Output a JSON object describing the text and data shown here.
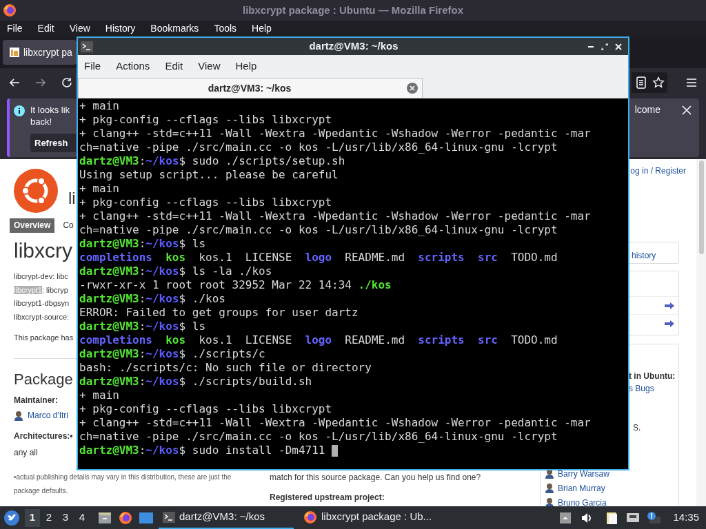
{
  "firefox": {
    "title": "libxcrypt package : Ubuntu — Mozilla Firefox",
    "menu": [
      "File",
      "Edit",
      "View",
      "History",
      "Bookmarks",
      "Tools",
      "Help"
    ],
    "tab": {
      "title": "libxcrypt pa"
    },
    "notification": {
      "lines": [
        "It looks lik",
        "back!"
      ],
      "button": "Refresh",
      "message_end": "lcome"
    }
  },
  "page": {
    "login": "og in / Register",
    "logo_subtitle": "li",
    "tabs": [
      {
        "label": "Overview",
        "selected": true
      },
      {
        "label": "Co",
        "selected": false
      }
    ],
    "heading": "libxcry",
    "packages": [
      {
        "name": "libcrypt-dev",
        "rest": ": libc",
        "selected": false
      },
      {
        "name": "libcrypt1",
        "rest": ": libcryp",
        "selected": true
      },
      {
        "name": "libcrypt1-dbgsyn",
        "selected": false
      },
      {
        "name": "libxcrypt-source",
        "rest": ":",
        "selected": false
      }
    ],
    "note": "This package has",
    "section_title": "Package",
    "maintainer_label": "Maintainer:",
    "maintainer": "Marco d'Itri",
    "architectures_label": "Architectures:•",
    "architectures": "any all",
    "footnote": [
      "•actual publishing details may vary in this distribution, these are just the",
      "package defaults."
    ],
    "upstream_note": "match for this source package. Can you help us find one?",
    "upstream_label": "Registered upstream project:",
    "sidebar": {
      "history_link": "history",
      "ubuntu_label": "t in Ubuntu:",
      "bugs_link": "s Bugs",
      "credit": "S.",
      "people": [
        "Barry Warsaw",
        "Brian Murray",
        "Bruno Garcia"
      ]
    }
  },
  "terminal": {
    "title": "dartz@VM3: ~/kos",
    "menu": [
      "File",
      "Actions",
      "Edit",
      "View",
      "Help"
    ],
    "tabs": [
      {
        "title": "dartz@VM3: ~/kos",
        "selected": true
      }
    ],
    "cursor": true,
    "lines": [
      {
        "kind": "output",
        "parts": [
          {
            "text": "+ main",
            "kind": "plain"
          }
        ]
      },
      {
        "kind": "output",
        "parts": [
          {
            "text": "+ pkg-config --cflags --libs libxcrypt",
            "kind": "plain"
          }
        ]
      },
      {
        "kind": "output",
        "parts": [
          {
            "text": "+ clang++ -std=c++11 -Wall -Wextra -Wpedantic -Wshadow -Werror -pedantic -mar",
            "kind": "plain"
          }
        ]
      },
      {
        "kind": "output",
        "parts": [
          {
            "text": "ch=native -pipe ./src/main.cc -o kos -L/usr/lib/x86_64-linux-gnu -lcrypt",
            "kind": "plain"
          }
        ]
      },
      {
        "kind": "prompt",
        "parts": [
          {
            "text": "dartz@VM3",
            "kind": "user"
          },
          {
            "text": ":",
            "kind": "plain"
          },
          {
            "text": "~/kos",
            "kind": "path"
          },
          {
            "text": "$ sudo ./scripts/setup.sh",
            "kind": "plain"
          }
        ]
      },
      {
        "kind": "output",
        "parts": [
          {
            "text": "Using setup script... please be careful",
            "kind": "plain"
          }
        ]
      },
      {
        "kind": "output",
        "parts": [
          {
            "text": "+ main",
            "kind": "plain"
          }
        ]
      },
      {
        "kind": "output",
        "parts": [
          {
            "text": "+ pkg-config --cflags --libs libxcrypt",
            "kind": "plain"
          }
        ]
      },
      {
        "kind": "output",
        "parts": [
          {
            "text": "+ clang++ -std=c++11 -Wall -Wextra -Wpedantic -Wshadow -Werror -pedantic -mar",
            "kind": "plain"
          }
        ]
      },
      {
        "kind": "output",
        "parts": [
          {
            "text": "ch=native -pipe ./src/main.cc -o kos -L/usr/lib/x86_64-linux-gnu -lcrypt",
            "kind": "plain"
          }
        ]
      },
      {
        "kind": "prompt",
        "parts": [
          {
            "text": "dartz@VM3",
            "kind": "user"
          },
          {
            "text": ":",
            "kind": "plain"
          },
          {
            "text": "~/kos",
            "kind": "path"
          },
          {
            "text": "$ ls",
            "kind": "plain"
          }
        ]
      },
      {
        "kind": "listing",
        "parts": [
          {
            "text": "completions",
            "kind": "dir"
          },
          {
            "text": "kos",
            "kind": "exec"
          },
          {
            "text": "kos.1",
            "kind": "plain"
          },
          {
            "text": "LICENSE",
            "kind": "plain"
          },
          {
            "text": "logo",
            "kind": "dir"
          },
          {
            "text": "README.md",
            "kind": "plain"
          },
          {
            "text": "scripts",
            "kind": "dir"
          },
          {
            "text": "src",
            "kind": "dir"
          },
          {
            "text": "TODO.md",
            "kind": "plain"
          }
        ]
      },
      {
        "kind": "prompt",
        "parts": [
          {
            "text": "dartz@VM3",
            "kind": "user"
          },
          {
            "text": ":",
            "kind": "plain"
          },
          {
            "text": "~/kos",
            "kind": "path"
          },
          {
            "text": "$ ls -la ./kos",
            "kind": "plain"
          }
        ]
      },
      {
        "kind": "output",
        "parts": [
          {
            "text": "-rwxr-xr-x 1 root root 32952 Mar 22 14:34",
            "kind": "plain"
          },
          {
            "text": "./kos",
            "kind": "exec"
          }
        ]
      },
      {
        "kind": "prompt",
        "parts": [
          {
            "text": "dartz@VM3",
            "kind": "user"
          },
          {
            "text": ":",
            "kind": "plain"
          },
          {
            "text": "~/kos",
            "kind": "path"
          },
          {
            "text": "$ ./kos",
            "kind": "plain"
          }
        ]
      },
      {
        "kind": "output",
        "parts": [
          {
            "text": "ERROR: Failed to get groups for user dartz",
            "kind": "plain"
          }
        ]
      },
      {
        "kind": "prompt",
        "parts": [
          {
            "text": "dartz@VM3",
            "kind": "user"
          },
          {
            "text": ":",
            "kind": "plain"
          },
          {
            "text": "~/kos",
            "kind": "path"
          },
          {
            "text": "$ ls",
            "kind": "plain"
          }
        ]
      },
      {
        "kind": "listing",
        "parts": [
          {
            "text": "completions",
            "kind": "dir"
          },
          {
            "text": "kos",
            "kind": "exec"
          },
          {
            "text": "kos.1",
            "kind": "plain"
          },
          {
            "text": "LICENSE",
            "kind": "plain"
          },
          {
            "text": "logo",
            "kind": "dir"
          },
          {
            "text": "README.md",
            "kind": "plain"
          },
          {
            "text": "scripts",
            "kind": "dir"
          },
          {
            "text": "src",
            "kind": "dir"
          },
          {
            "text": "TODO.md",
            "kind": "plain"
          }
        ]
      },
      {
        "kind": "prompt",
        "parts": [
          {
            "text": "dartz@VM3",
            "kind": "user"
          },
          {
            "text": ":",
            "kind": "plain"
          },
          {
            "text": "~/kos",
            "kind": "path"
          },
          {
            "text": "$ ./scripts/c",
            "kind": "plain"
          }
        ]
      },
      {
        "kind": "output",
        "parts": [
          {
            "text": "bash: ./scripts/c: No such file or directory",
            "kind": "plain"
          }
        ]
      },
      {
        "kind": "prompt",
        "parts": [
          {
            "text": "dartz@VM3",
            "kind": "user"
          },
          {
            "text": ":",
            "kind": "plain"
          },
          {
            "text": "~/kos",
            "kind": "path"
          },
          {
            "text": "$ ./scripts/build.sh",
            "kind": "plain"
          }
        ]
      },
      {
        "kind": "output",
        "parts": [
          {
            "text": "+ main",
            "kind": "plain"
          }
        ]
      },
      {
        "kind": "output",
        "parts": [
          {
            "text": "+ pkg-config --cflags --libs libxcrypt",
            "kind": "plain"
          }
        ]
      },
      {
        "kind": "output",
        "parts": [
          {
            "text": "+ clang++ -std=c++11 -Wall -Wextra -Wpedantic -Wshadow -Werror -pedantic -mar",
            "kind": "plain"
          }
        ]
      },
      {
        "kind": "output",
        "parts": [
          {
            "text": "ch=native -pipe ./src/main.cc -o kos -L/usr/lib/x86_64-linux-gnu -lcrypt",
            "kind": "plain"
          }
        ]
      },
      {
        "kind": "prompt",
        "parts": [
          {
            "text": "dartz@VM3",
            "kind": "user"
          },
          {
            "text": ":",
            "kind": "plain"
          },
          {
            "text": "~/kos",
            "kind": "path"
          },
          {
            "text": "$ sudo install -Dm4711",
            "kind": "plain"
          }
        ]
      }
    ]
  },
  "taskbar": {
    "workspaces": [
      {
        "label": "1",
        "selected": true
      },
      {
        "label": "2",
        "selected": false
      },
      {
        "label": "3",
        "selected": false
      },
      {
        "label": "4",
        "selected": false
      }
    ],
    "tasks": [
      {
        "title": "dartz@VM3: ~/kos",
        "kind": "terminal",
        "active": true
      },
      {
        "title": "libxcrypt package : Ub...",
        "kind": "browser",
        "active": false
      }
    ],
    "clock": "14:35"
  }
}
